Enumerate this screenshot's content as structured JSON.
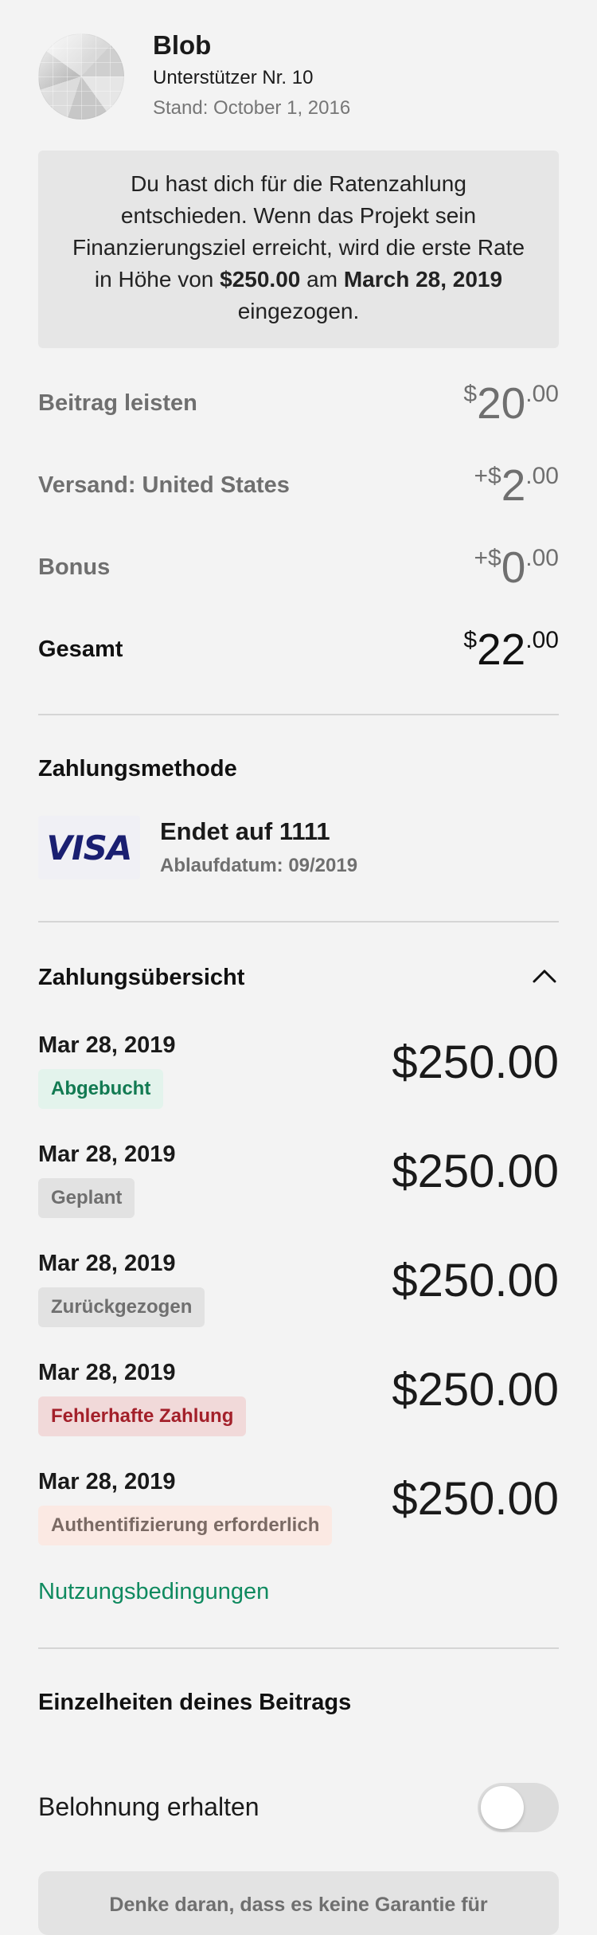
{
  "header": {
    "name": "Blob",
    "backer": "Unterstützer Nr. 10",
    "date": "Stand: October 1, 2016"
  },
  "notice": {
    "part1": "Du hast dich für die Ratenzahlung entschieden. Wenn das Projekt sein Finanzierungsziel erreicht, wird die erste Rate in Höhe von ",
    "amount": "$250.00",
    "part2": " am ",
    "date": "March 28, 2019",
    "part3": " eingezogen."
  },
  "summary": {
    "pledge": {
      "label": "Beitrag leisten",
      "prefix": "$",
      "whole": "20",
      "decimal": ".00"
    },
    "shipping": {
      "label": "Versand: United States",
      "prefix": "+$",
      "whole": "2",
      "decimal": ".00"
    },
    "bonus": {
      "label": "Bonus",
      "prefix": "+$",
      "whole": "0",
      "decimal": ".00"
    },
    "total": {
      "label": "Gesamt",
      "prefix": "$",
      "whole": "22",
      "decimal": ".00"
    }
  },
  "payment_method": {
    "title": "Zahlungsmethode",
    "brand": "VISA",
    "ending": "Endet auf 1111",
    "expiry": "Ablaufdatum: 09/2019"
  },
  "schedule": {
    "title": "Zahlungsübersicht",
    "items": [
      {
        "date": "Mar 28, 2019",
        "status": "Abgebucht",
        "amount": "$250.00",
        "badge_bg": "#e3f3ec",
        "badge_fg": "#127a52"
      },
      {
        "date": "Mar 28, 2019",
        "status": "Geplant",
        "amount": "$250.00",
        "badge_bg": "#e2e2e2",
        "badge_fg": "#6f6f6f"
      },
      {
        "date": "Mar 28, 2019",
        "status": "Zurückgezogen",
        "amount": "$250.00",
        "badge_bg": "#e2e2e2",
        "badge_fg": "#6f6f6f"
      },
      {
        "date": "Mar 28, 2019",
        "status": "Fehlerhafte Zahlung",
        "amount": "$250.00",
        "badge_bg": "#f1d9d9",
        "badge_fg": "#a3202a"
      },
      {
        "date": "Mar 28, 2019",
        "status": "Authentifizierung erforderlich",
        "amount": "$250.00",
        "badge_bg": "#fbe9e3",
        "badge_fg": "#7a6a64"
      }
    ]
  },
  "terms_link": "Nutzungsbedingungen",
  "details": {
    "title": "Einzelheiten deines Beitrags",
    "reward_label": "Belohnung erhalten",
    "reward_on": false
  },
  "reminder": "Denke daran, dass es keine Garantie für",
  "colors": {
    "accent": "#0f8a5f",
    "background": "#f3f3f3"
  }
}
